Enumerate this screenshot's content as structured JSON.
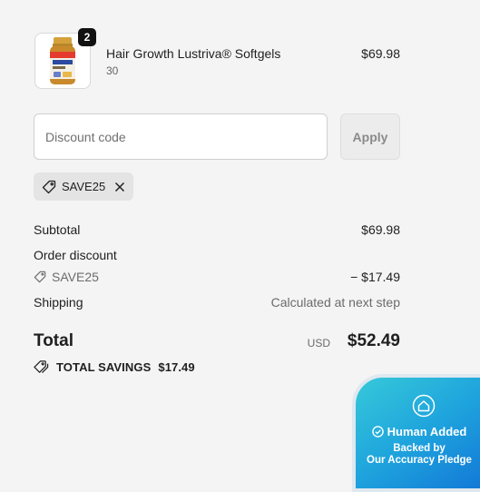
{
  "cart": {
    "items": [
      {
        "name": "Hair Growth Lustriva® Softgels",
        "variant": "30",
        "price": "$69.98",
        "quantity": "2",
        "thumbnail_icon": "supplement-bottle-image"
      }
    ]
  },
  "discount": {
    "placeholder": "Discount code",
    "value": "",
    "apply_label": "Apply",
    "applied_code": "SAVE25"
  },
  "summary": {
    "subtotal_label": "Subtotal",
    "subtotal_value": "$69.98",
    "order_discount_label": "Order discount",
    "discount_code": "SAVE25",
    "discount_value": "− $17.49",
    "shipping_label": "Shipping",
    "shipping_value": "Calculated at next step",
    "total_label": "Total",
    "currency": "USD",
    "total_value": "$52.49",
    "savings_label": "TOTAL SAVINGS",
    "savings_value": "$17.49"
  },
  "pledge": {
    "title": "Human Added",
    "line1": "Backed by",
    "line2": "Our Accuracy Pledge",
    "gradient_start": "#36c9d9",
    "gradient_end": "#1275d6"
  }
}
